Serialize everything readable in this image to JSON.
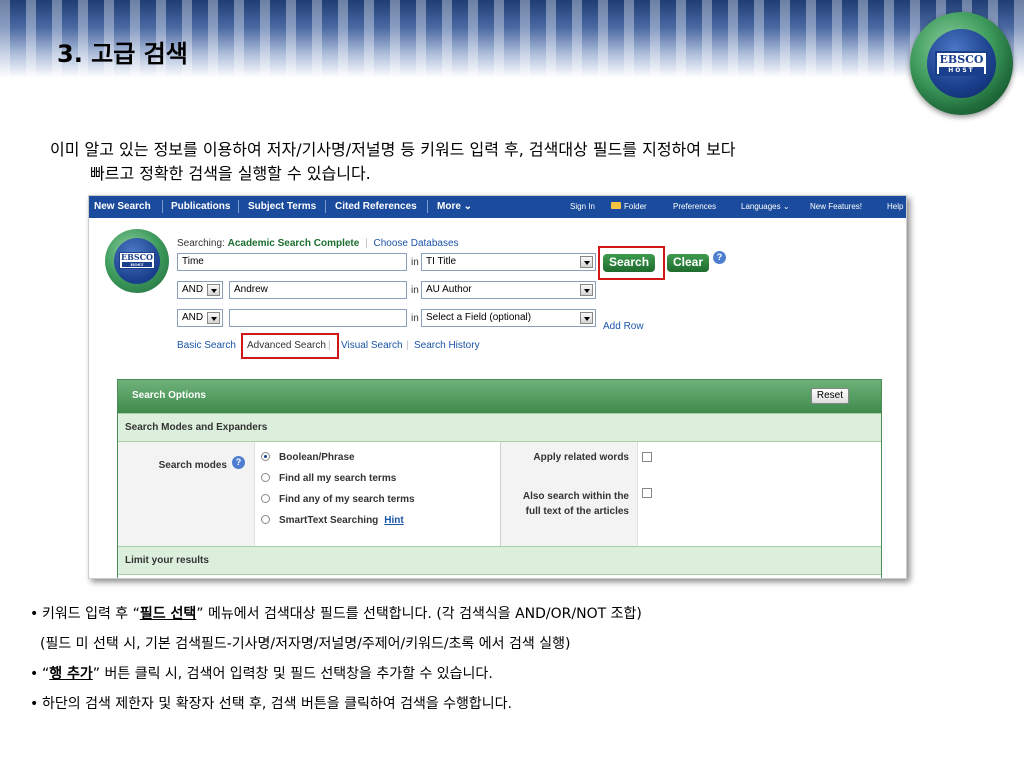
{
  "slide": {
    "title": "3. 고급 검색",
    "intro_line1": "이미 알고 있는 정보를 이용하여 저자/기사명/저널명 등 키워드 입력 후, 검색대상 필드를 지정하여 보다",
    "intro_line2": "빠르고 정확한 검색을 실행할 수 있습니다.",
    "logo_text": "EBSCO",
    "logo_sub": "HOST"
  },
  "navbar": {
    "items": [
      "New Search",
      "Publications",
      "Subject Terms",
      "Cited References",
      "More ⌄"
    ],
    "right_items": [
      "Sign In",
      "Folder",
      "Preferences",
      "Languages ⌄",
      "New Features!",
      "Help"
    ]
  },
  "search": {
    "searching_label": "Searching:",
    "database": "Academic Search Complete",
    "choose_databases": "Choose Databases",
    "in_label": "in",
    "rows": [
      {
        "operator": "",
        "term": "Time",
        "field": "TI Title"
      },
      {
        "operator": "AND",
        "term": "Andrew",
        "field": "AU Author"
      },
      {
        "operator": "AND",
        "term": "",
        "field": "Select a Field (optional)"
      }
    ],
    "search_button": "Search",
    "clear_button": "Clear",
    "help_icon": "?",
    "add_row": "Add Row",
    "links": [
      "Basic Search",
      "Advanced Search",
      "Visual Search",
      "Search History"
    ]
  },
  "options": {
    "title": "Search Options",
    "reset": "Reset",
    "modes_section": "Search Modes and Expanders",
    "search_modes_label": "Search modes",
    "modes": [
      "Boolean/Phrase",
      "Find all my search terms",
      "Find any of my search terms",
      "SmartText Searching"
    ],
    "selected_mode": "Boolean/Phrase",
    "hint": "Hint",
    "apply_related": "Apply related words",
    "also_search": "Also search within the full text of the articles",
    "limit_section": "Limit your results"
  },
  "bullets": {
    "b1_pre": "키워드 입력 후 “",
    "b1_bold": "필드 선택",
    "b1_post": "” 메뉴에서 검색대상 필드를 선택합니다. (각 검색식을 AND/OR/NOT 조합)",
    "b1_sub": "(필드 미 선택 시, 기본 검색필드-기사명/저자명/저널명/주제어/키워드/초록 에서 검색 실행)",
    "b2_pre": "“",
    "b2_bold": "행 추가",
    "b2_post": "” 버튼 클릭 시, 검색어 입력창 및 필드 선택창을 추가할 수 있습니다.",
    "b3": "하단의 검색 제한자 및 확장자 선택 후, 검색 버튼을 클릭하여 검색을 수행합니다."
  },
  "colors": {
    "accent_green": "#3f8a4c",
    "nav_blue": "#1a4b9c",
    "highlight_red": "#d01818"
  }
}
